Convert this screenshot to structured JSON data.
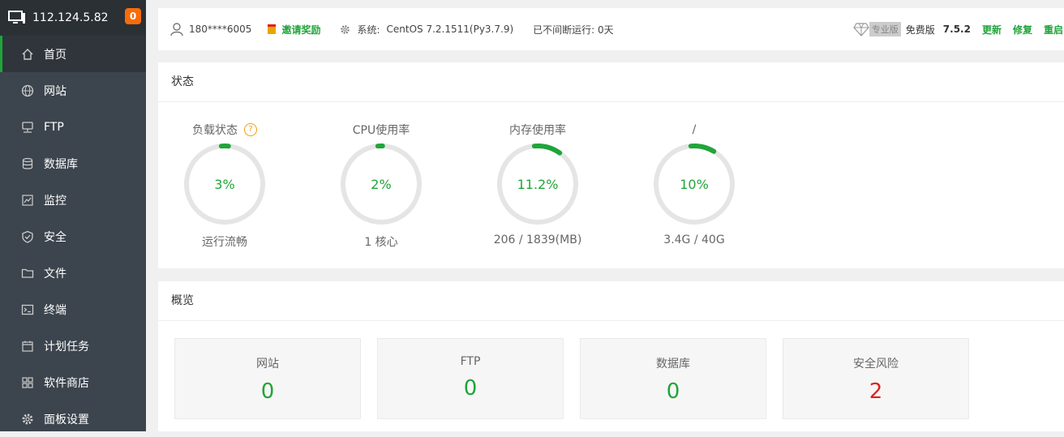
{
  "sidebar": {
    "ip": "112.124.5.82",
    "badge": "0",
    "items": [
      {
        "label": "首页",
        "icon": "home-icon",
        "active": true
      },
      {
        "label": "网站",
        "icon": "globe-icon"
      },
      {
        "label": "FTP",
        "icon": "ftp-icon"
      },
      {
        "label": "数据库",
        "icon": "database-icon"
      },
      {
        "label": "监控",
        "icon": "monitor-icon"
      },
      {
        "label": "安全",
        "icon": "shield-icon"
      },
      {
        "label": "文件",
        "icon": "folder-icon"
      },
      {
        "label": "终端",
        "icon": "terminal-icon"
      },
      {
        "label": "计划任务",
        "icon": "calendar-icon"
      },
      {
        "label": "软件商店",
        "icon": "grid-icon"
      },
      {
        "label": "面板设置",
        "icon": "gear-icon"
      }
    ]
  },
  "header": {
    "user": "180****6005",
    "invite": "邀请奖励",
    "system_label": "系统:",
    "system_value": "CentOS 7.2.1511(Py3.7.9)",
    "uptime": "已不间断运行: 0天",
    "pro_tag": "专业版",
    "edition": "免费版",
    "version": "7.5.2",
    "update": "更新",
    "repair": "修复",
    "restart": "重启"
  },
  "status": {
    "title": "状态",
    "gauges": [
      {
        "label": "负载状态",
        "value": "3%",
        "fraction": 0.03,
        "sub": "运行流畅",
        "help": "?"
      },
      {
        "label": "CPU使用率",
        "value": "2%",
        "fraction": 0.02,
        "sub": "1 核心"
      },
      {
        "label": "内存使用率",
        "value": "11.2%",
        "fraction": 0.112,
        "sub": "206 / 1839(MB)"
      },
      {
        "label": "/",
        "value": "10%",
        "fraction": 0.1,
        "sub": "3.4G / 40G"
      }
    ]
  },
  "overview": {
    "title": "概览",
    "cards": [
      {
        "label": "网站",
        "value": "0"
      },
      {
        "label": "FTP",
        "value": "0"
      },
      {
        "label": "数据库",
        "value": "0"
      },
      {
        "label": "安全风险",
        "value": "2"
      }
    ]
  },
  "colors": {
    "accent": "#20a53a",
    "danger": "#e02020",
    "sidebar": "#3c444d",
    "badge": "#f66c0b"
  }
}
